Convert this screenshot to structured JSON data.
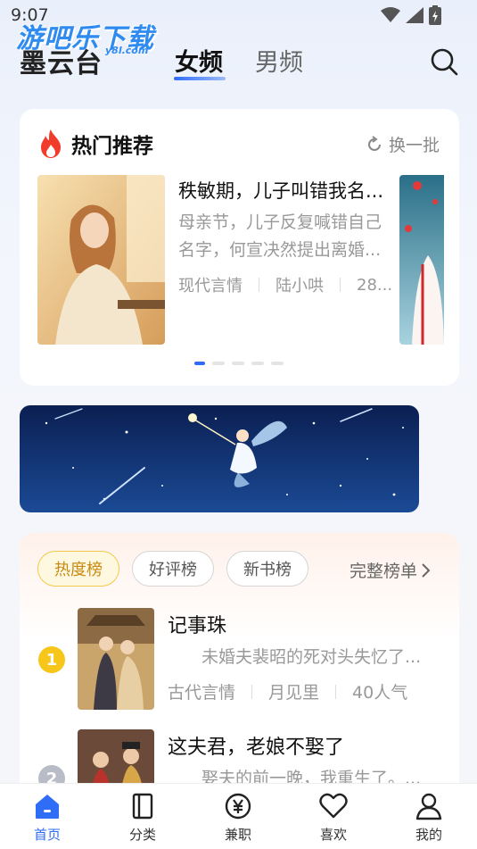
{
  "status_bar": {
    "time": "9:07"
  },
  "watermark": {
    "main": "游吧乐下载",
    "sub": "y8l.com"
  },
  "header": {
    "brand": "墨云台",
    "tabs": [
      {
        "label": "女频",
        "active": true
      },
      {
        "label": "男频",
        "active": false
      }
    ]
  },
  "hot": {
    "title": "热门推荐",
    "refresh_label": "换一批",
    "book": {
      "title": "秩敏期，儿子叫错我名...",
      "desc": "母亲节，儿子反复喊错自己名字，何宣决然提出离婚...",
      "category": "现代言情",
      "author": "陆小哄",
      "extra": "28..."
    },
    "carousel_count": 5,
    "carousel_active": 0
  },
  "rank": {
    "tabs": [
      "热度榜",
      "好评榜",
      "新书榜"
    ],
    "active_tab": 0,
    "full_list_label": "完整榜单",
    "items": [
      {
        "rank": "1",
        "title": "记事珠",
        "desc": "未婚夫裴昭的死对头失忆了...",
        "category": "古代言情",
        "author": "月见里",
        "popularity": "40人气"
      },
      {
        "rank": "2",
        "title": "这夫君，老娘不娶了",
        "desc": "娶夫的前一晚，我重生了。...",
        "category": "",
        "author": "",
        "popularity": ""
      }
    ]
  },
  "bottom_nav": [
    {
      "label": "首页",
      "icon": "home-icon",
      "active": true
    },
    {
      "label": "分类",
      "icon": "book-icon",
      "active": false
    },
    {
      "label": "兼职",
      "icon": "yuan-icon",
      "active": false
    },
    {
      "label": "喜欢",
      "icon": "heart-icon",
      "active": false
    },
    {
      "label": "我的",
      "icon": "user-icon",
      "active": false
    }
  ],
  "colors": {
    "accent": "#2f6df6",
    "rank_gold": "#f7c61a",
    "chip_active": "#c88a12"
  }
}
